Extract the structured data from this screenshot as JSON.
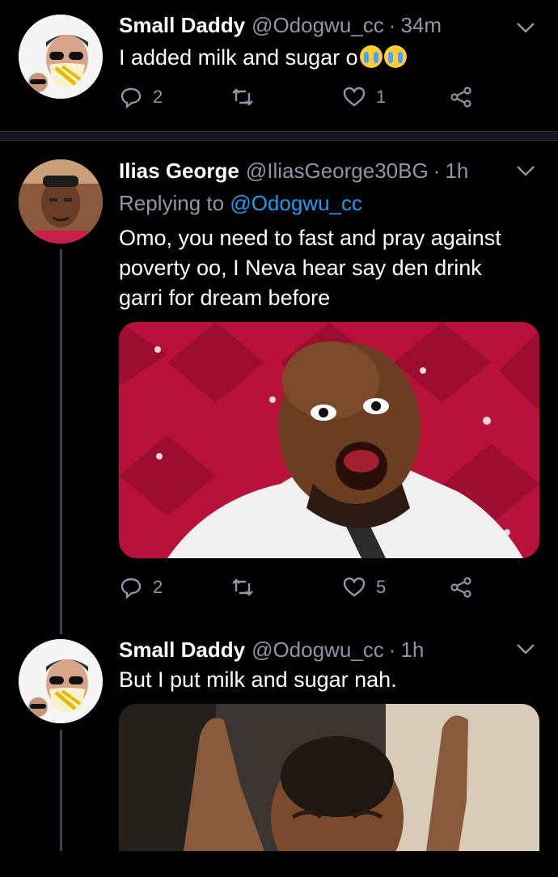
{
  "tweets": [
    {
      "name": "Small Daddy",
      "handle": "@Odogwu_cc",
      "time": "34m",
      "text": "I added milk and sugar o",
      "emoji": "loudly-crying-face-icon ×2",
      "reply_count": "2",
      "like_count": "1"
    },
    {
      "name": "Ilias George",
      "handle": "@IliasGeorge30BG",
      "time": "1h",
      "replying_prefix": "Replying to",
      "replying_handle": "@Odogwu_cc",
      "text": "Omo, you need to fast and pray against poverty oo, I Neva hear say den drink garri for dream before",
      "reply_count": "2",
      "like_count": "5"
    },
    {
      "name": "Small Daddy",
      "handle": "@Odogwu_cc",
      "time": "1h",
      "text": "But I put milk and sugar nah."
    }
  ],
  "colors": {
    "background": "#000000",
    "secondary_text": "#8b98a5",
    "mention": "#1d9bf0",
    "thread_line": "#3d4247"
  }
}
